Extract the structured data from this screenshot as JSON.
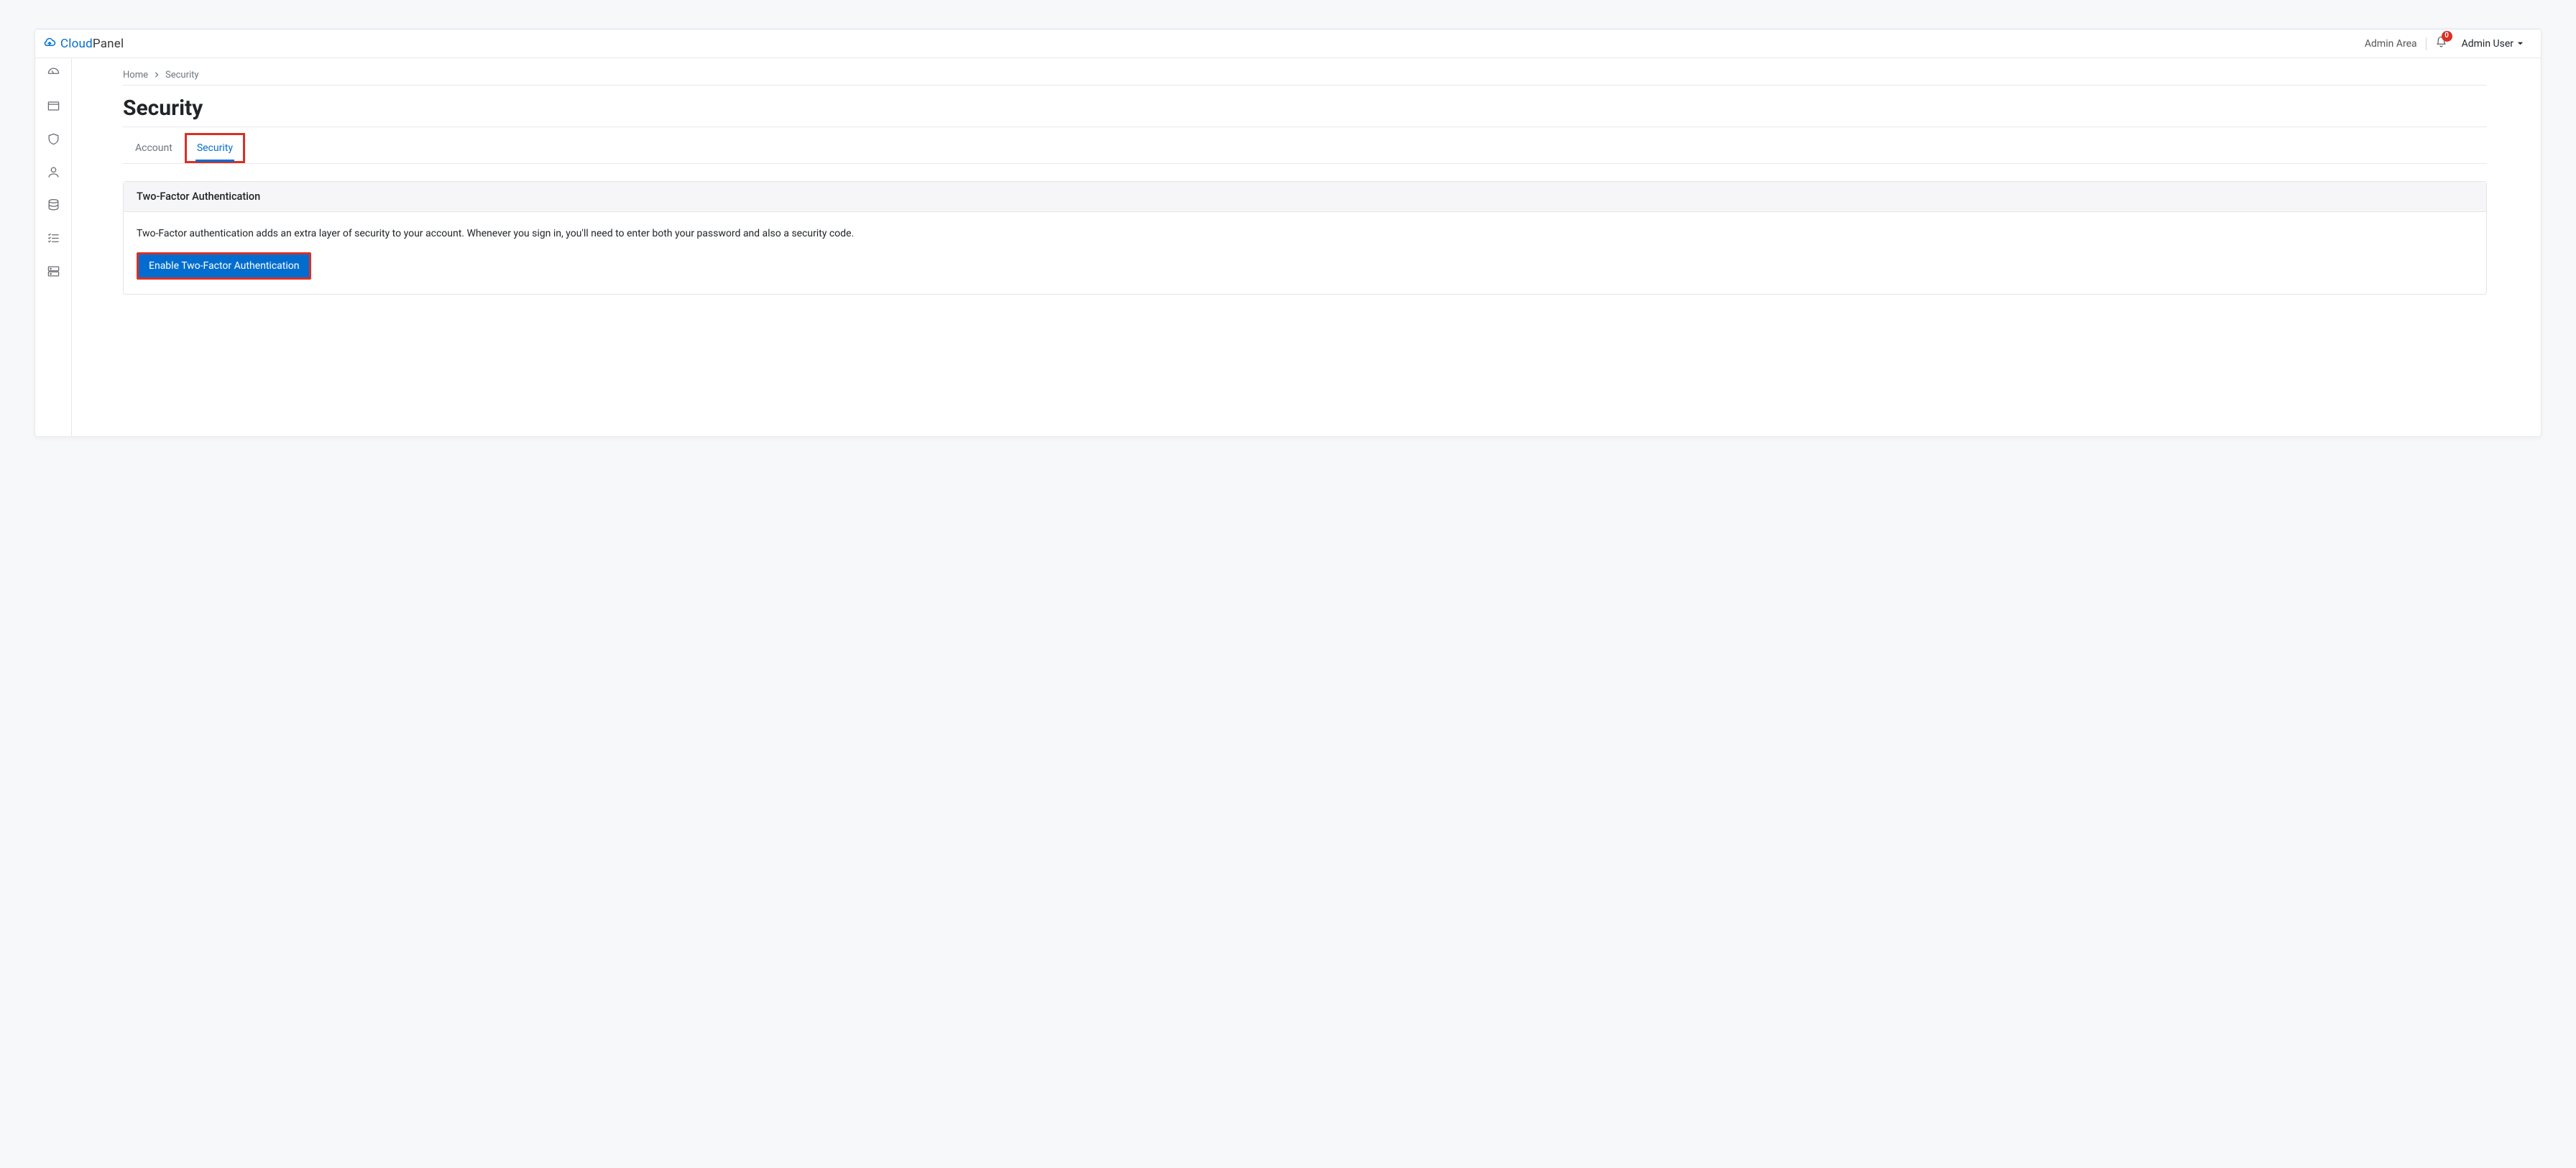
{
  "brand": {
    "cloud": "Cloud",
    "panel": "Panel"
  },
  "header": {
    "admin_area": "Admin Area",
    "notifications_count": "0",
    "user_label": "Admin User"
  },
  "breadcrumb": {
    "home": "Home",
    "current": "Security"
  },
  "page_title": "Security",
  "tabs": {
    "account": "Account",
    "security": "Security"
  },
  "card": {
    "title": "Two-Factor Authentication",
    "description": "Two-Factor authentication adds an extra layer of security to your account. Whenever you sign in, you'll need to enter both your password and also a security code.",
    "button": "Enable Two-Factor Authentication"
  }
}
